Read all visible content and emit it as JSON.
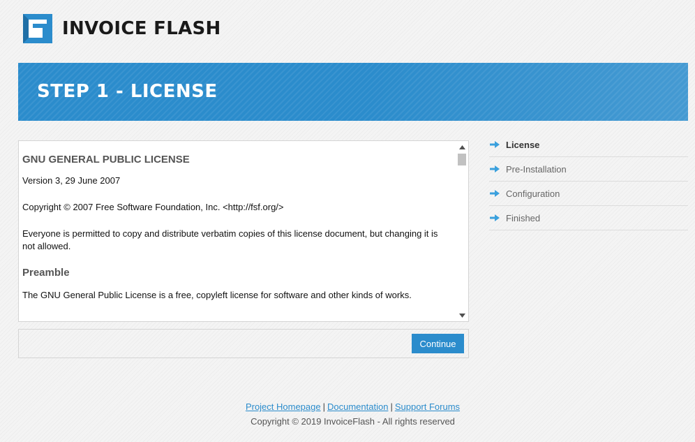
{
  "app": {
    "logo_text": "INVOICE FLASH"
  },
  "banner": {
    "title": "STEP 1 - LICENSE"
  },
  "license": {
    "heading": "GNU GENERAL PUBLIC LICENSE",
    "version": "Version 3, 29 June 2007",
    "copyright": "Copyright © 2007 Free Software Foundation, Inc. <http://fsf.org/>",
    "permission": "Everyone is permitted to copy and distribute verbatim copies of this license document, but changing it is not allowed.",
    "preamble_heading": "Preamble",
    "preamble_text": "The GNU General Public License is a free, copyleft license for software and other kinds of works."
  },
  "actions": {
    "continue_label": "Continue"
  },
  "steps": [
    {
      "label": "License",
      "active": true
    },
    {
      "label": "Pre-Installation",
      "active": false
    },
    {
      "label": "Configuration",
      "active": false
    },
    {
      "label": "Finished",
      "active": false
    }
  ],
  "footer": {
    "links": [
      "Project Homepage",
      "Documentation",
      "Support Forums"
    ],
    "separator": "|",
    "copyright": "Copyright © 2019 InvoiceFlash - All rights reserved"
  },
  "colors": {
    "accent": "#2b8ccc",
    "arrow": "#3aa0dd"
  }
}
